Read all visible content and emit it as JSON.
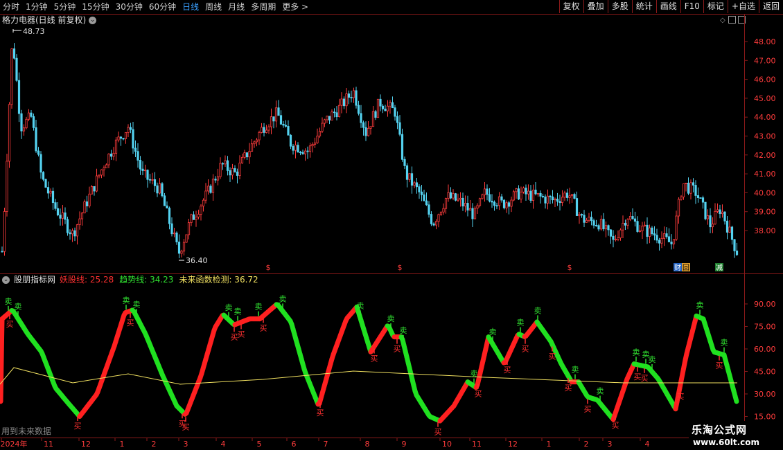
{
  "toolbar": {
    "periods": [
      "分时",
      "1分钟",
      "5分钟",
      "15分钟",
      "30分钟",
      "60分钟",
      "日线",
      "周线",
      "月线",
      "多周期",
      "更多 >"
    ],
    "active_period": "日线",
    "tools": [
      "复权",
      "叠加",
      "多股",
      "统计",
      "画线",
      "F10",
      "标记",
      "+自选",
      "返回"
    ]
  },
  "main_chart": {
    "title": "格力电器(日线 前复权)",
    "high_label": "48.73",
    "low_label": "36.40",
    "y_ticks": [
      "48.00",
      "47.00",
      "46.00",
      "45.00",
      "44.00",
      "43.00",
      "42.00",
      "41.00",
      "40.00",
      "39.00",
      "38.00"
    ],
    "markers": [
      "$",
      "$",
      "$"
    ],
    "tags": [
      "财",
      "回",
      "减"
    ]
  },
  "indicator": {
    "name": "股朋指标网",
    "lines": [
      {
        "label": "妖股线:",
        "value": "25.28",
        "color": "#ff3030"
      },
      {
        "label": "趋势线:",
        "value": "34.23",
        "color": "#30e030"
      },
      {
        "label": "未来函数检测:",
        "value": "36.72",
        "color": "#f0e060"
      }
    ],
    "y_ticks": [
      "90.00",
      "75.00",
      "60.00",
      "45.00",
      "30.00",
      "15.00"
    ],
    "buy_label": "买",
    "sell_label": "卖"
  },
  "footer": {
    "future_text": "用到未来数据",
    "x_labels": [
      "2024年",
      "11",
      "12",
      "1",
      "2",
      "3",
      "4",
      "5",
      "6",
      "7",
      "8",
      "9",
      "10",
      "11",
      "12",
      "1",
      "2",
      "3",
      "4"
    ]
  },
  "brand": {
    "name": "乐淘公式网",
    "url": "www.60lt.com"
  },
  "chart_data": [
    {
      "type": "candlestick",
      "title": "格力电器(日线 前复权)",
      "ylim": [
        36.4,
        48.73
      ],
      "annotations": {
        "high": 48.73,
        "low": 36.4
      }
    },
    {
      "type": "line",
      "ylim": [
        15,
        100
      ],
      "series": [
        {
          "name": "妖股线",
          "last": 25.28
        },
        {
          "name": "趋势线",
          "last": 34.23
        },
        {
          "name": "未来函数检测",
          "last": 36.72
        }
      ]
    }
  ]
}
